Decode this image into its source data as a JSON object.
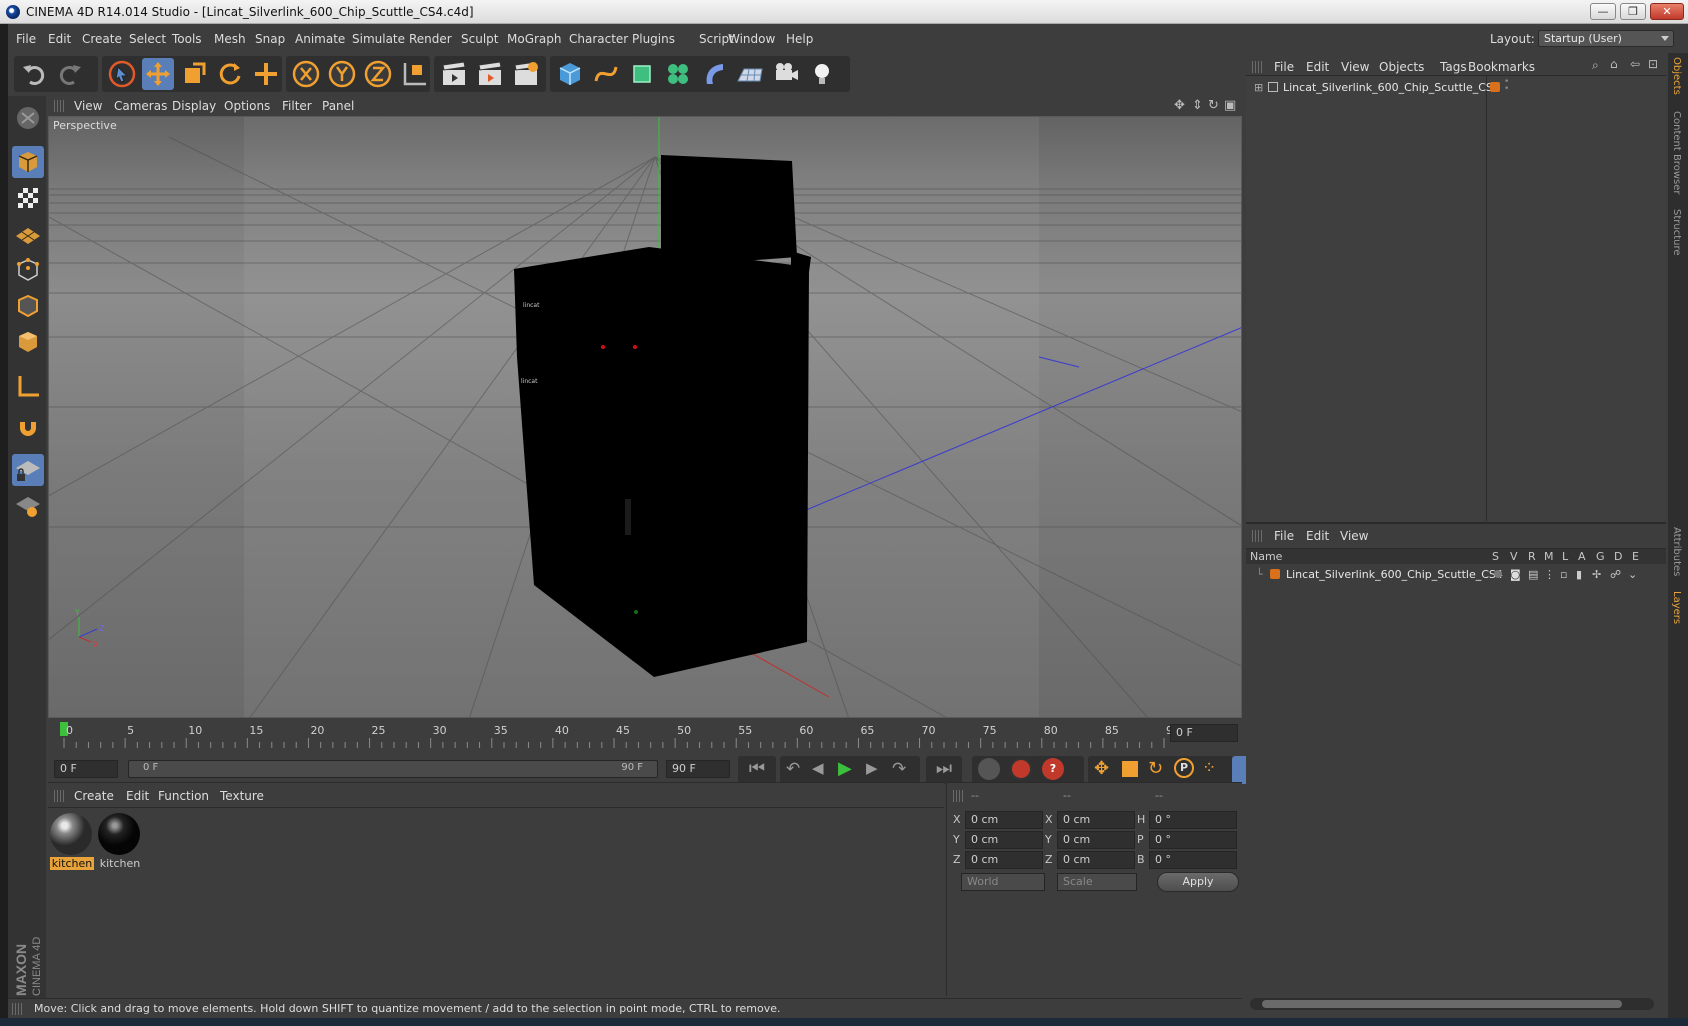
{
  "window": {
    "title": "CINEMA 4D R14.014 Studio - [Lincat_Silverlink_600_Chip_Scuttle_CS4.c4d]",
    "minimize": "—",
    "maximize": "❐",
    "close": "✕"
  },
  "menubar": {
    "items": [
      "File",
      "Edit",
      "Create",
      "Select",
      "Tools",
      "Mesh",
      "Snap",
      "Animate",
      "Simulate",
      "Render",
      "Sculpt",
      "MoGraph",
      "Character",
      "Plugins",
      "Script",
      "Window",
      "Help"
    ],
    "layout_label": "Layout:",
    "layout_value": "Startup (User)"
  },
  "viewport": {
    "menu": [
      "View",
      "Cameras",
      "Display",
      "Options",
      "Filter",
      "Panel"
    ],
    "label": "Perspective",
    "axis_x": "X",
    "axis_y": "Y",
    "axis_z": "Z",
    "model_badge_1": "lincat",
    "model_badge_2": "lincat"
  },
  "timeline": {
    "ticks": [
      "0",
      "5",
      "10",
      "15",
      "20",
      "25",
      "30",
      "35",
      "40",
      "45",
      "50",
      "55",
      "60",
      "65",
      "70",
      "75",
      "80",
      "85",
      "90"
    ],
    "current_frame": "0 F",
    "start_field": "0 F",
    "range_start": "0 F",
    "range_end": "90 F",
    "end_field": "90 F"
  },
  "materials": {
    "menu": [
      "Create",
      "Edit",
      "Function",
      "Texture"
    ],
    "items": [
      {
        "label": "kitchen",
        "selected": true
      },
      {
        "label": "kitchen",
        "selected": false
      }
    ]
  },
  "coordinates": {
    "header": [
      "--",
      "--",
      "--"
    ],
    "rows": [
      {
        "l1": "X",
        "v1": "0 cm",
        "l2": "X",
        "v2": "0 cm",
        "l3": "H",
        "v3": "0 °"
      },
      {
        "l1": "Y",
        "v1": "0 cm",
        "l2": "Y",
        "v2": "0 cm",
        "l3": "P",
        "v3": "0 °"
      },
      {
        "l1": "Z",
        "v1": "0 cm",
        "l2": "Z",
        "v2": "0 cm",
        "l3": "B",
        "v3": "0 °"
      }
    ],
    "world_select": "World",
    "scale_select": "Scale",
    "apply": "Apply"
  },
  "objects_panel": {
    "menu": [
      "File",
      "Edit",
      "View",
      "Objects",
      "Tags",
      "Bookmarks"
    ],
    "object_name": "Lincat_Silverlink_600_Chip_Scuttle_CS4"
  },
  "layers_panel": {
    "menu": [
      "File",
      "Edit",
      "View"
    ],
    "name_header": "Name",
    "columns": [
      "S",
      "V",
      "R",
      "M",
      "L",
      "A",
      "G",
      "D",
      "E"
    ],
    "layer_name": "Lincat_Silverlink_600_Chip_Scuttle_CS4"
  },
  "side_tabs": [
    "Objects",
    "Content Browser",
    "Structure",
    "Attributes",
    "Layers"
  ],
  "status": {
    "text": "Move: Click and drag to move elements. Hold down SHIFT to quantize movement / add to the selection in point mode, CTRL to remove."
  },
  "branding": {
    "maxon": "MAXON",
    "cinema": "CINEMA 4D"
  },
  "colors": {
    "accent": "#e8a33a",
    "active_tool": "#5a7fb8",
    "panel": "#3d3d3d"
  }
}
